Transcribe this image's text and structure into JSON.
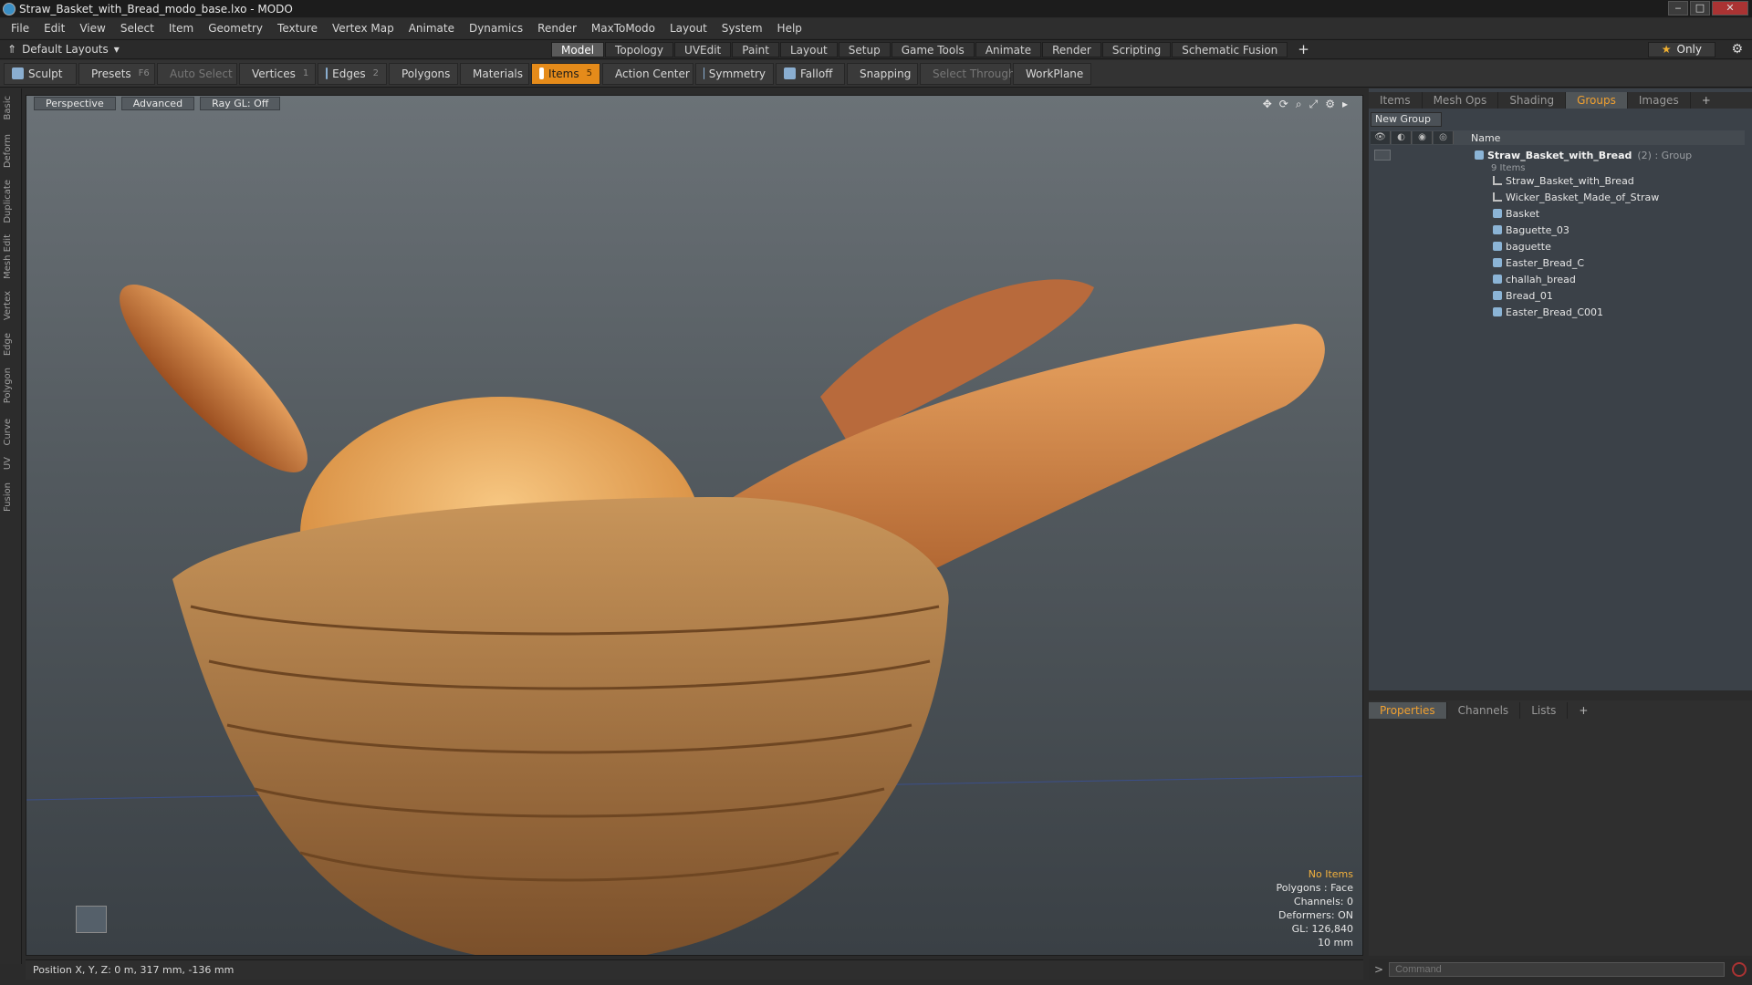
{
  "window": {
    "title": "Straw_Basket_with_Bread_modo_base.lxo - MODO"
  },
  "menu": [
    "File",
    "Edit",
    "View",
    "Select",
    "Item",
    "Geometry",
    "Texture",
    "Vertex Map",
    "Animate",
    "Dynamics",
    "Render",
    "MaxToModo",
    "Layout",
    "System",
    "Help"
  ],
  "modebar": {
    "layouts_label": "Default Layouts",
    "tabs": [
      "Model",
      "Topology",
      "UVEdit",
      "Paint",
      "Layout",
      "Setup",
      "Game Tools",
      "Animate",
      "Render",
      "Scripting",
      "Schematic Fusion"
    ],
    "active_tab": "Model",
    "plus": "+",
    "only_label": "Only"
  },
  "toolbar": {
    "sculpt": "Sculpt",
    "presets": "Presets",
    "presets_key": "F6",
    "auto_select": "Auto Select",
    "vertices": "Vertices",
    "vertices_key": "1",
    "edges": "Edges",
    "edges_key": "2",
    "polygons": "Polygons",
    "materials": "Materials",
    "items": "Items",
    "items_key": "5",
    "action_center": "Action Center",
    "symmetry": "Symmetry",
    "falloff": "Falloff",
    "snapping": "Snapping",
    "select_through": "Select Through",
    "workplane": "WorkPlane"
  },
  "left_tabs": [
    "Basic",
    "Deform",
    "Duplicate",
    "Mesh Edit",
    "Vertex",
    "Edge",
    "Polygon",
    "Curve",
    "UV",
    "Fusion"
  ],
  "viewport": {
    "perspective": "Perspective",
    "advanced": "Advanced",
    "raygl": "Ray GL: Off",
    "hud": {
      "no_items": "No Items",
      "polygons": "Polygons : Face",
      "channels": "Channels: 0",
      "deformers": "Deformers: ON",
      "gl": "GL: 126,840",
      "grid": "10 mm"
    }
  },
  "status": {
    "position": "Position X, Y, Z:  0 m, 317 mm, -136 mm"
  },
  "panel": {
    "tabs": [
      "Items",
      "Mesh Ops",
      "Shading",
      "Groups",
      "Images"
    ],
    "active_tab": "Groups",
    "plus": "+",
    "new_group": "New Group",
    "name_header": "Name",
    "group_title": "Straw_Basket_with_Bread",
    "group_sub": "(2) : Group",
    "item_count": "9 Items",
    "items": [
      "Straw_Basket_with_Bread",
      "Wicker_Basket_Made_of_Straw",
      "Basket",
      "Baguette_03",
      "baguette",
      "Easter_Bread_C",
      "challah_bread",
      "Bread_01",
      "Easter_Bread_C001"
    ]
  },
  "props": {
    "tabs": [
      "Properties",
      "Channels",
      "Lists"
    ],
    "active_tab": "Properties",
    "plus": "+"
  },
  "command": {
    "placeholder": "Command"
  }
}
